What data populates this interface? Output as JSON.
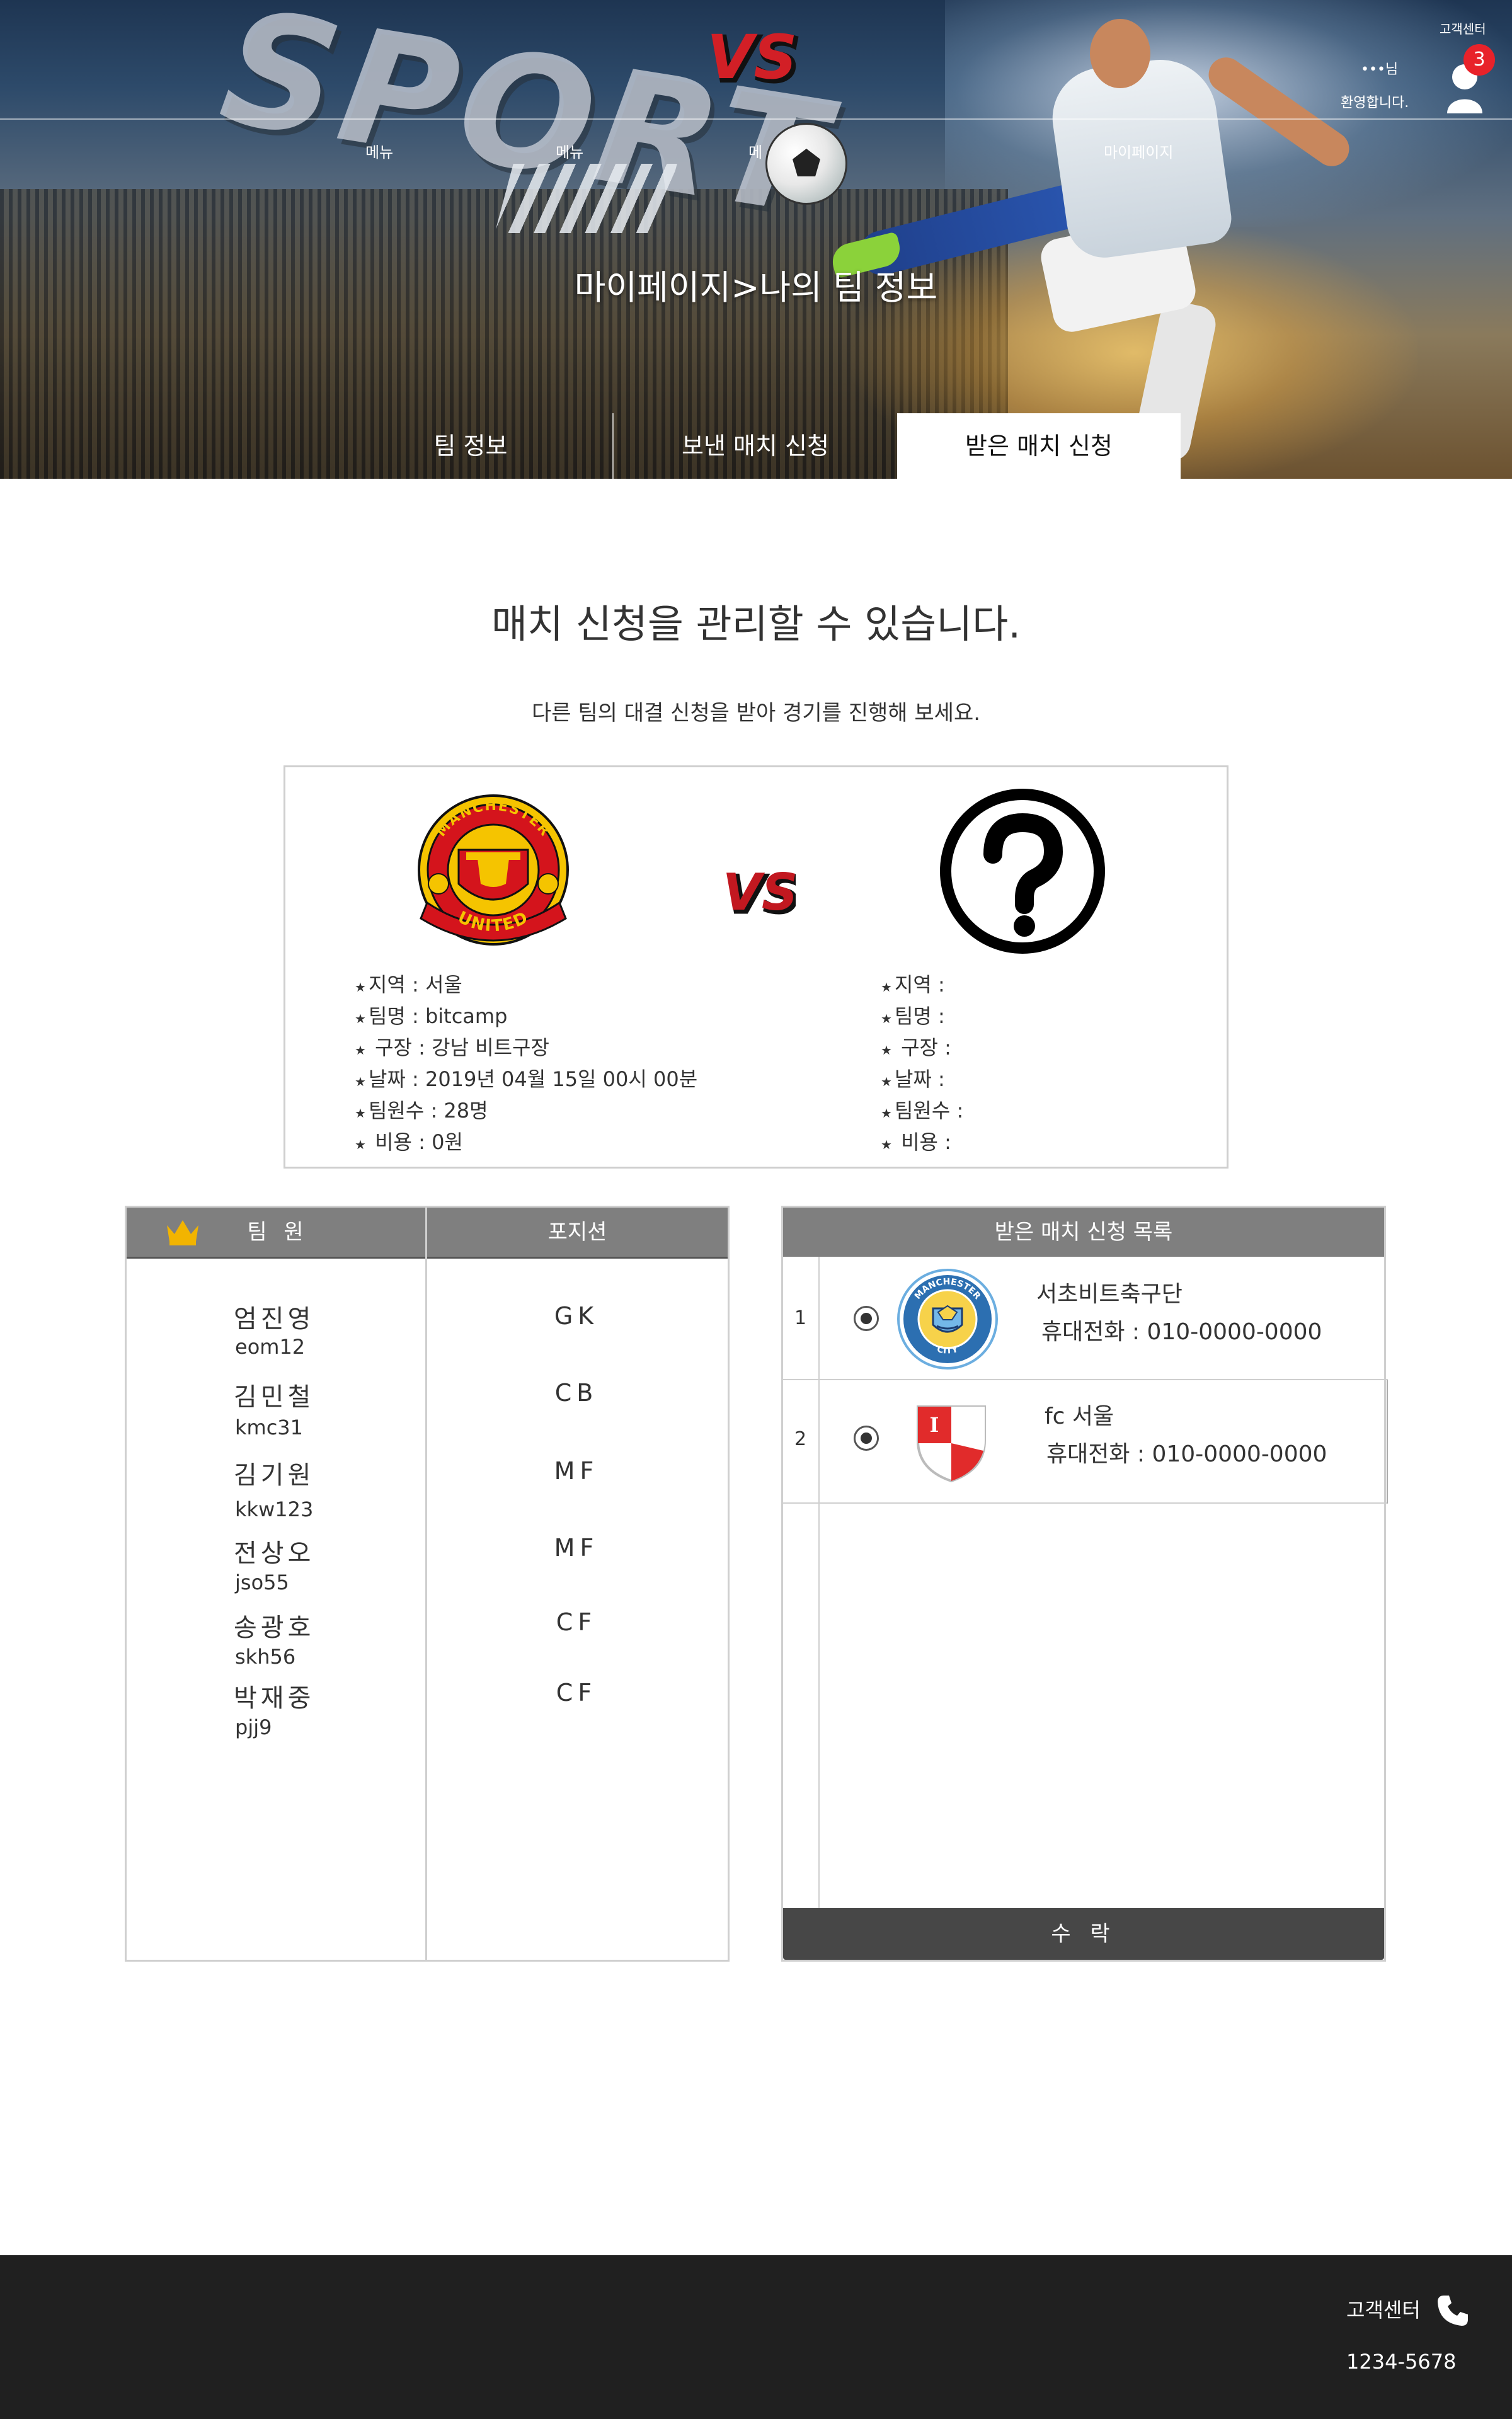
{
  "header": {
    "brand_art_text": "SPORT",
    "logo_text": "VS",
    "support_label": "고객센터",
    "greeting_name": "•••님",
    "greeting_message": "환영합니다.",
    "notification_count": "3",
    "nav_items": [
      "메뉴",
      "메뉴",
      "메",
      "마이페이지"
    ],
    "page_title": "마이페이지>나의 팀 정보",
    "tabs": [
      {
        "label": "팀 정보",
        "active": false
      },
      {
        "label": "보낸 매치 신청",
        "active": false
      },
      {
        "label": "받은 매치 신청",
        "active": true
      }
    ]
  },
  "intro": {
    "title": "매치 신청을 관리할 수 있습니다.",
    "subtitle": "다른 팀의 대결 신청을 받아 경기를 진행해 보세요."
  },
  "match": {
    "vs_label": "VS",
    "home": {
      "logo_top": "MANCHESTER",
      "logo_bottom": "UNITED",
      "info": [
        {
          "key": "지역",
          "value": " : 서울"
        },
        {
          "key": "팀명",
          "value": " : bitcamp"
        },
        {
          "key": " 구장",
          "value": " :  강남 비트구장"
        },
        {
          "key": "날짜",
          "value": " :  2019년 04월 15일 00시 00분"
        },
        {
          "key": "팀원수",
          "value": " :  28명"
        },
        {
          "key": " 비용",
          "value": " :  0원"
        }
      ]
    },
    "away": {
      "logo": "question-mark",
      "info": [
        {
          "key": "지역",
          "value": " :"
        },
        {
          "key": "팀명",
          "value": " :"
        },
        {
          "key": " 구장",
          "value": " :"
        },
        {
          "key": "날짜",
          "value": " :"
        },
        {
          "key": "팀원수",
          "value": " :"
        },
        {
          "key": " 비용",
          "value": " :"
        }
      ]
    }
  },
  "members": {
    "header_member": "팀 원",
    "header_position": "포지션",
    "rows": [
      {
        "name": "엄진영",
        "id": "eom12",
        "position": "GK"
      },
      {
        "name": "김민철",
        "id": "kmc31",
        "position": "CB"
      },
      {
        "name": "김기원",
        "id": "kkw123",
        "position": "MF"
      },
      {
        "name": "전상오",
        "id": "jso55",
        "position": "MF"
      },
      {
        "name": "송광호",
        "id": "skh56",
        "position": "CF"
      },
      {
        "name": "박재중",
        "id": "pjj9",
        "position": "CF"
      }
    ]
  },
  "received": {
    "header": "받은 매치 신청 목록",
    "items": [
      {
        "num": "1",
        "team": "서초비트축구단",
        "phone": "휴대전화 : 010-0000-0000",
        "logo": "manchester-city-crest",
        "logo_text_top": "MANCHESTER",
        "logo_text_bottom": "CITY",
        "selected": true
      },
      {
        "num": "2",
        "team": "fc 서울",
        "phone": "휴대전화 : 010-0000-0000",
        "logo": "red-white-shield",
        "logo_letter": "I",
        "selected": true
      }
    ],
    "accept_label": "수 락"
  },
  "footer": {
    "support_label": "고객센터",
    "phone_number": "1234-5678"
  },
  "colors": {
    "accent_red": "#e8222a",
    "header_gray": "#7f7f7f",
    "button_dark": "#474747",
    "footer_bg": "#202020"
  }
}
